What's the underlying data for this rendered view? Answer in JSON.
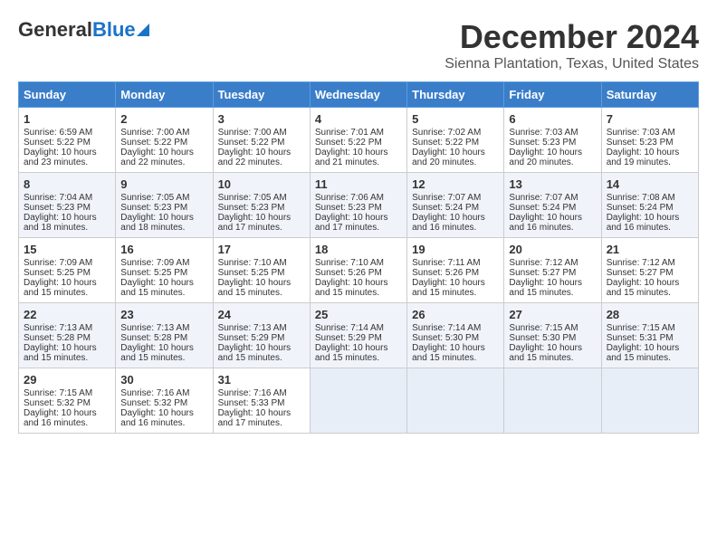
{
  "header": {
    "logo_general": "General",
    "logo_blue": "Blue",
    "title": "December 2024",
    "subtitle": "Sienna Plantation, Texas, United States"
  },
  "days_of_week": [
    "Sunday",
    "Monday",
    "Tuesday",
    "Wednesday",
    "Thursday",
    "Friday",
    "Saturday"
  ],
  "weeks": [
    [
      {
        "day": "1",
        "lines": [
          "Sunrise: 6:59 AM",
          "Sunset: 5:22 PM",
          "Daylight: 10 hours",
          "and 23 minutes."
        ]
      },
      {
        "day": "2",
        "lines": [
          "Sunrise: 7:00 AM",
          "Sunset: 5:22 PM",
          "Daylight: 10 hours",
          "and 22 minutes."
        ]
      },
      {
        "day": "3",
        "lines": [
          "Sunrise: 7:00 AM",
          "Sunset: 5:22 PM",
          "Daylight: 10 hours",
          "and 22 minutes."
        ]
      },
      {
        "day": "4",
        "lines": [
          "Sunrise: 7:01 AM",
          "Sunset: 5:22 PM",
          "Daylight: 10 hours",
          "and 21 minutes."
        ]
      },
      {
        "day": "5",
        "lines": [
          "Sunrise: 7:02 AM",
          "Sunset: 5:22 PM",
          "Daylight: 10 hours",
          "and 20 minutes."
        ]
      },
      {
        "day": "6",
        "lines": [
          "Sunrise: 7:03 AM",
          "Sunset: 5:23 PM",
          "Daylight: 10 hours",
          "and 20 minutes."
        ]
      },
      {
        "day": "7",
        "lines": [
          "Sunrise: 7:03 AM",
          "Sunset: 5:23 PM",
          "Daylight: 10 hours",
          "and 19 minutes."
        ]
      }
    ],
    [
      {
        "day": "8",
        "lines": [
          "Sunrise: 7:04 AM",
          "Sunset: 5:23 PM",
          "Daylight: 10 hours",
          "and 18 minutes."
        ]
      },
      {
        "day": "9",
        "lines": [
          "Sunrise: 7:05 AM",
          "Sunset: 5:23 PM",
          "Daylight: 10 hours",
          "and 18 minutes."
        ]
      },
      {
        "day": "10",
        "lines": [
          "Sunrise: 7:05 AM",
          "Sunset: 5:23 PM",
          "Daylight: 10 hours",
          "and 17 minutes."
        ]
      },
      {
        "day": "11",
        "lines": [
          "Sunrise: 7:06 AM",
          "Sunset: 5:23 PM",
          "Daylight: 10 hours",
          "and 17 minutes."
        ]
      },
      {
        "day": "12",
        "lines": [
          "Sunrise: 7:07 AM",
          "Sunset: 5:24 PM",
          "Daylight: 10 hours",
          "and 16 minutes."
        ]
      },
      {
        "day": "13",
        "lines": [
          "Sunrise: 7:07 AM",
          "Sunset: 5:24 PM",
          "Daylight: 10 hours",
          "and 16 minutes."
        ]
      },
      {
        "day": "14",
        "lines": [
          "Sunrise: 7:08 AM",
          "Sunset: 5:24 PM",
          "Daylight: 10 hours",
          "and 16 minutes."
        ]
      }
    ],
    [
      {
        "day": "15",
        "lines": [
          "Sunrise: 7:09 AM",
          "Sunset: 5:25 PM",
          "Daylight: 10 hours",
          "and 15 minutes."
        ]
      },
      {
        "day": "16",
        "lines": [
          "Sunrise: 7:09 AM",
          "Sunset: 5:25 PM",
          "Daylight: 10 hours",
          "and 15 minutes."
        ]
      },
      {
        "day": "17",
        "lines": [
          "Sunrise: 7:10 AM",
          "Sunset: 5:25 PM",
          "Daylight: 10 hours",
          "and 15 minutes."
        ]
      },
      {
        "day": "18",
        "lines": [
          "Sunrise: 7:10 AM",
          "Sunset: 5:26 PM",
          "Daylight: 10 hours",
          "and 15 minutes."
        ]
      },
      {
        "day": "19",
        "lines": [
          "Sunrise: 7:11 AM",
          "Sunset: 5:26 PM",
          "Daylight: 10 hours",
          "and 15 minutes."
        ]
      },
      {
        "day": "20",
        "lines": [
          "Sunrise: 7:12 AM",
          "Sunset: 5:27 PM",
          "Daylight: 10 hours",
          "and 15 minutes."
        ]
      },
      {
        "day": "21",
        "lines": [
          "Sunrise: 7:12 AM",
          "Sunset: 5:27 PM",
          "Daylight: 10 hours",
          "and 15 minutes."
        ]
      }
    ],
    [
      {
        "day": "22",
        "lines": [
          "Sunrise: 7:13 AM",
          "Sunset: 5:28 PM",
          "Daylight: 10 hours",
          "and 15 minutes."
        ]
      },
      {
        "day": "23",
        "lines": [
          "Sunrise: 7:13 AM",
          "Sunset: 5:28 PM",
          "Daylight: 10 hours",
          "and 15 minutes."
        ]
      },
      {
        "day": "24",
        "lines": [
          "Sunrise: 7:13 AM",
          "Sunset: 5:29 PM",
          "Daylight: 10 hours",
          "and 15 minutes."
        ]
      },
      {
        "day": "25",
        "lines": [
          "Sunrise: 7:14 AM",
          "Sunset: 5:29 PM",
          "Daylight: 10 hours",
          "and 15 minutes."
        ]
      },
      {
        "day": "26",
        "lines": [
          "Sunrise: 7:14 AM",
          "Sunset: 5:30 PM",
          "Daylight: 10 hours",
          "and 15 minutes."
        ]
      },
      {
        "day": "27",
        "lines": [
          "Sunrise: 7:15 AM",
          "Sunset: 5:30 PM",
          "Daylight: 10 hours",
          "and 15 minutes."
        ]
      },
      {
        "day": "28",
        "lines": [
          "Sunrise: 7:15 AM",
          "Sunset: 5:31 PM",
          "Daylight: 10 hours",
          "and 15 minutes."
        ]
      }
    ],
    [
      {
        "day": "29",
        "lines": [
          "Sunrise: 7:15 AM",
          "Sunset: 5:32 PM",
          "Daylight: 10 hours",
          "and 16 minutes."
        ]
      },
      {
        "day": "30",
        "lines": [
          "Sunrise: 7:16 AM",
          "Sunset: 5:32 PM",
          "Daylight: 10 hours",
          "and 16 minutes."
        ]
      },
      {
        "day": "31",
        "lines": [
          "Sunrise: 7:16 AM",
          "Sunset: 5:33 PM",
          "Daylight: 10 hours",
          "and 17 minutes."
        ]
      },
      {
        "day": "",
        "lines": []
      },
      {
        "day": "",
        "lines": []
      },
      {
        "day": "",
        "lines": []
      },
      {
        "day": "",
        "lines": []
      }
    ]
  ]
}
